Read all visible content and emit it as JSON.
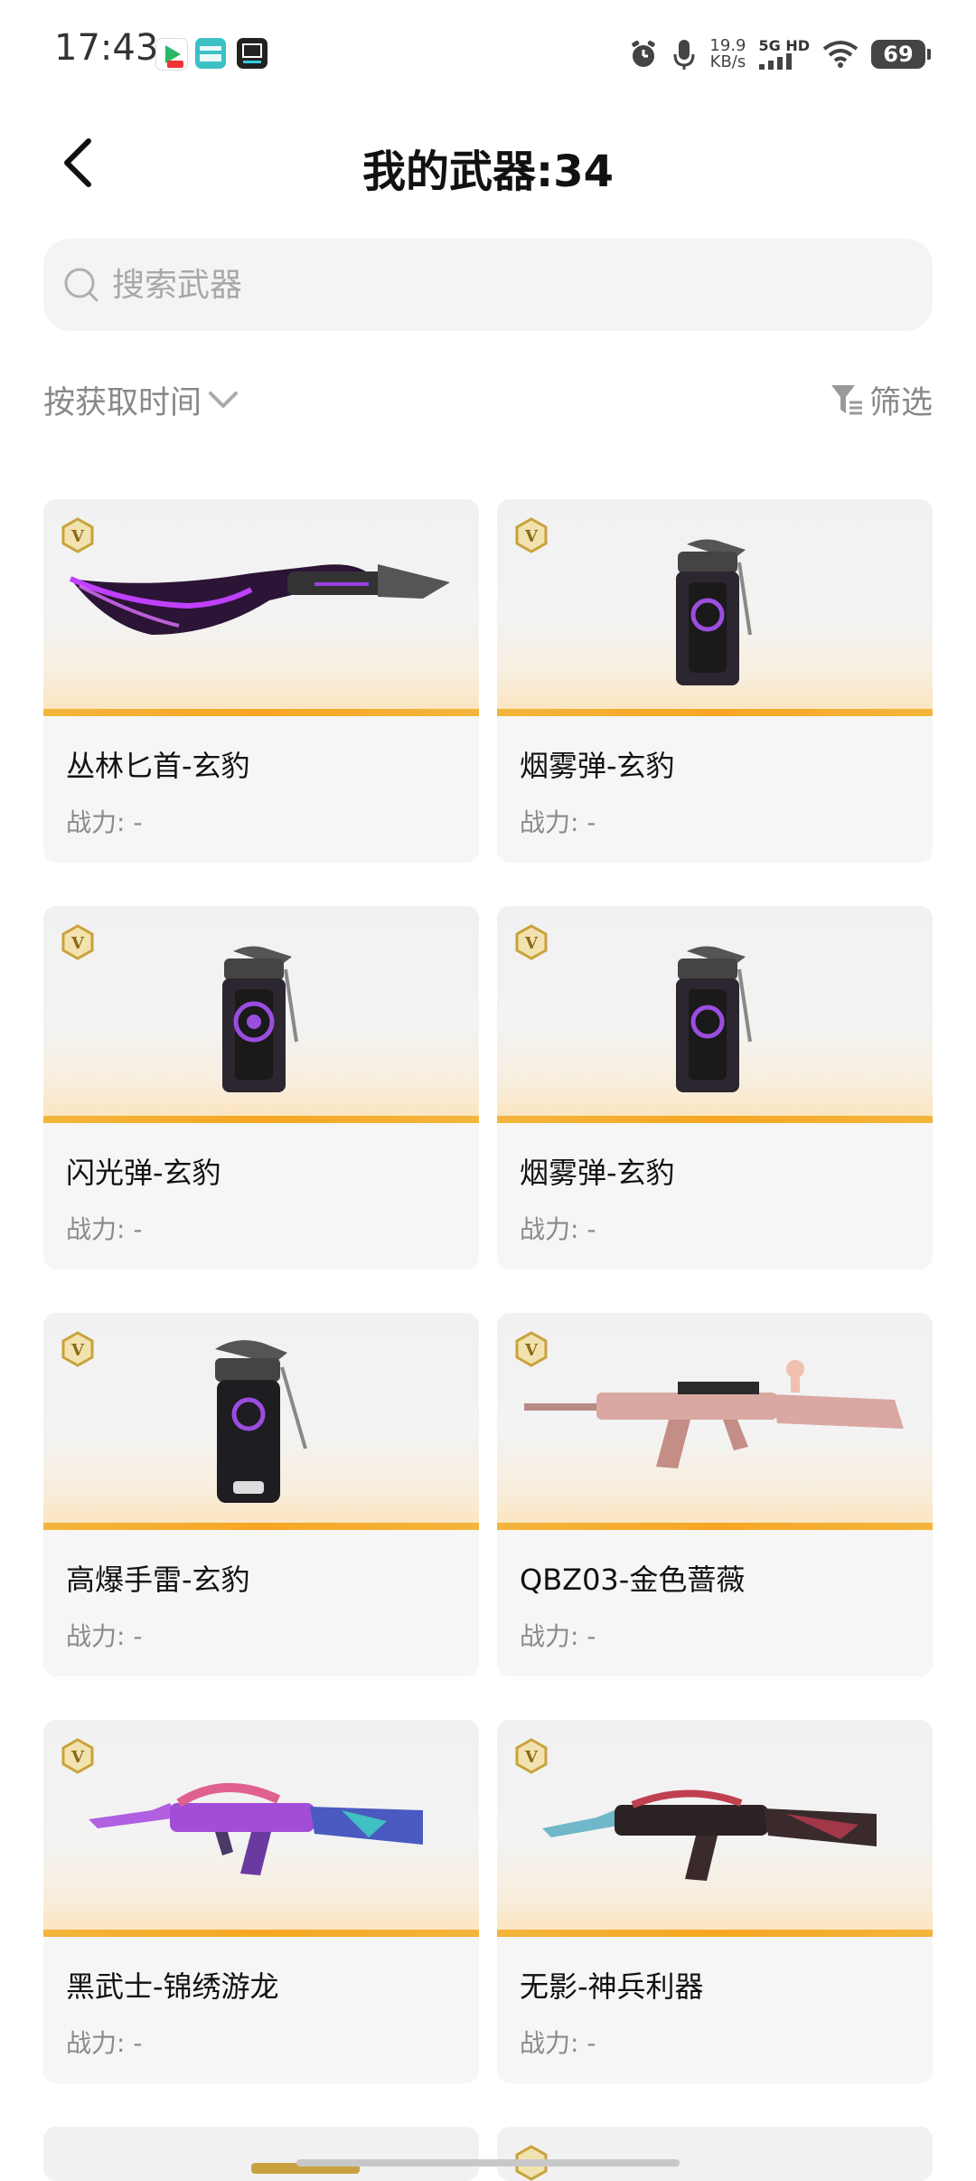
{
  "status_bar": {
    "time": "17:43",
    "net_speed_value": "19.9",
    "net_speed_unit": "KB/s",
    "network_type": "5G HD",
    "battery": "69",
    "app_icons": [
      "video-app-icon",
      "boss-zhipin-icon",
      "news-app-icon"
    ]
  },
  "header": {
    "title": "我的武器:34"
  },
  "search": {
    "placeholder": "搜索武器"
  },
  "toolbar": {
    "sort_label": "按获取时间",
    "filter_label": "筛选"
  },
  "weapons": [
    {
      "name": "丛林匕首-玄豹",
      "power": "战力: -",
      "badge": "V",
      "art": "knife-purple"
    },
    {
      "name": "烟雾弹-玄豹",
      "power": "战力: -",
      "badge": "V",
      "art": "grenade-canister"
    },
    {
      "name": "闪光弹-玄豹",
      "power": "战力: -",
      "badge": "V",
      "art": "grenade-canister"
    },
    {
      "name": "烟雾弹-玄豹",
      "power": "战力: -",
      "badge": "V",
      "art": "grenade-canister"
    },
    {
      "name": "高爆手雷-玄豹",
      "power": "战力: -",
      "badge": "V",
      "art": "grenade-canister-large"
    },
    {
      "name": "QBZ03-金色蔷薇",
      "power": "战力: -",
      "badge": "V",
      "art": "rifle-pink"
    },
    {
      "name": "黑武士-锦绣游龙",
      "power": "战力: -",
      "badge": "V",
      "art": "rifle-dragon"
    },
    {
      "name": "无影-神兵利器",
      "power": "战力: -",
      "badge": "V",
      "art": "rifle-dark"
    }
  ],
  "colors": {
    "accent_stripe": "#f6a623",
    "card_bg": "#f6f6f6",
    "badge_gold": "#c9a23a",
    "muted_text": "#8a8a8a"
  }
}
